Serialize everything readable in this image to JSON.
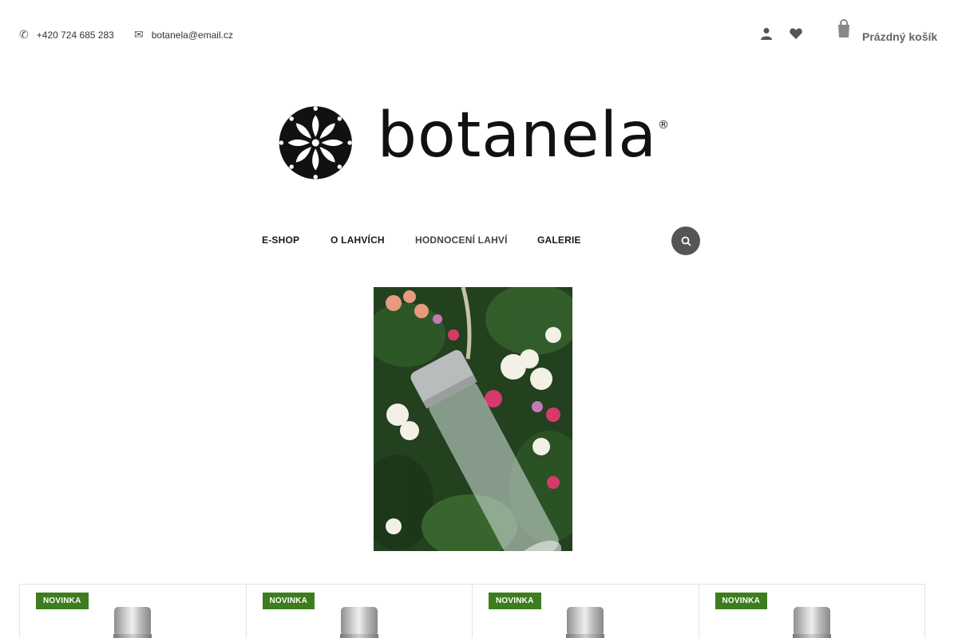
{
  "header": {
    "phone": "+420 724 685 283",
    "email": "botanela@email.cz",
    "cart_label": "Prázdný košík",
    "icons": {
      "phone": "phone-icon",
      "email": "envelope-icon",
      "user": "user-icon",
      "wishlist": "heart-icon",
      "cart": "cart-icon"
    }
  },
  "logo": {
    "text": "botanela",
    "registered": "®"
  },
  "nav": {
    "items": [
      {
        "label": "E-SHOP"
      },
      {
        "label": "O LAHVÍCH"
      },
      {
        "label": "HODNOCENÍ LAHVÍ"
      },
      {
        "label": "GALERIE"
      }
    ],
    "search_icon": "search-icon"
  },
  "products": [
    {
      "badge": "NOVINKA"
    },
    {
      "badge": "NOVINKA"
    },
    {
      "badge": "NOVINKA"
    },
    {
      "badge": "NOVINKA"
    }
  ],
  "colors": {
    "badge": "#3d7d1e",
    "search_button": "#555555",
    "text": "#1a1a1a"
  }
}
